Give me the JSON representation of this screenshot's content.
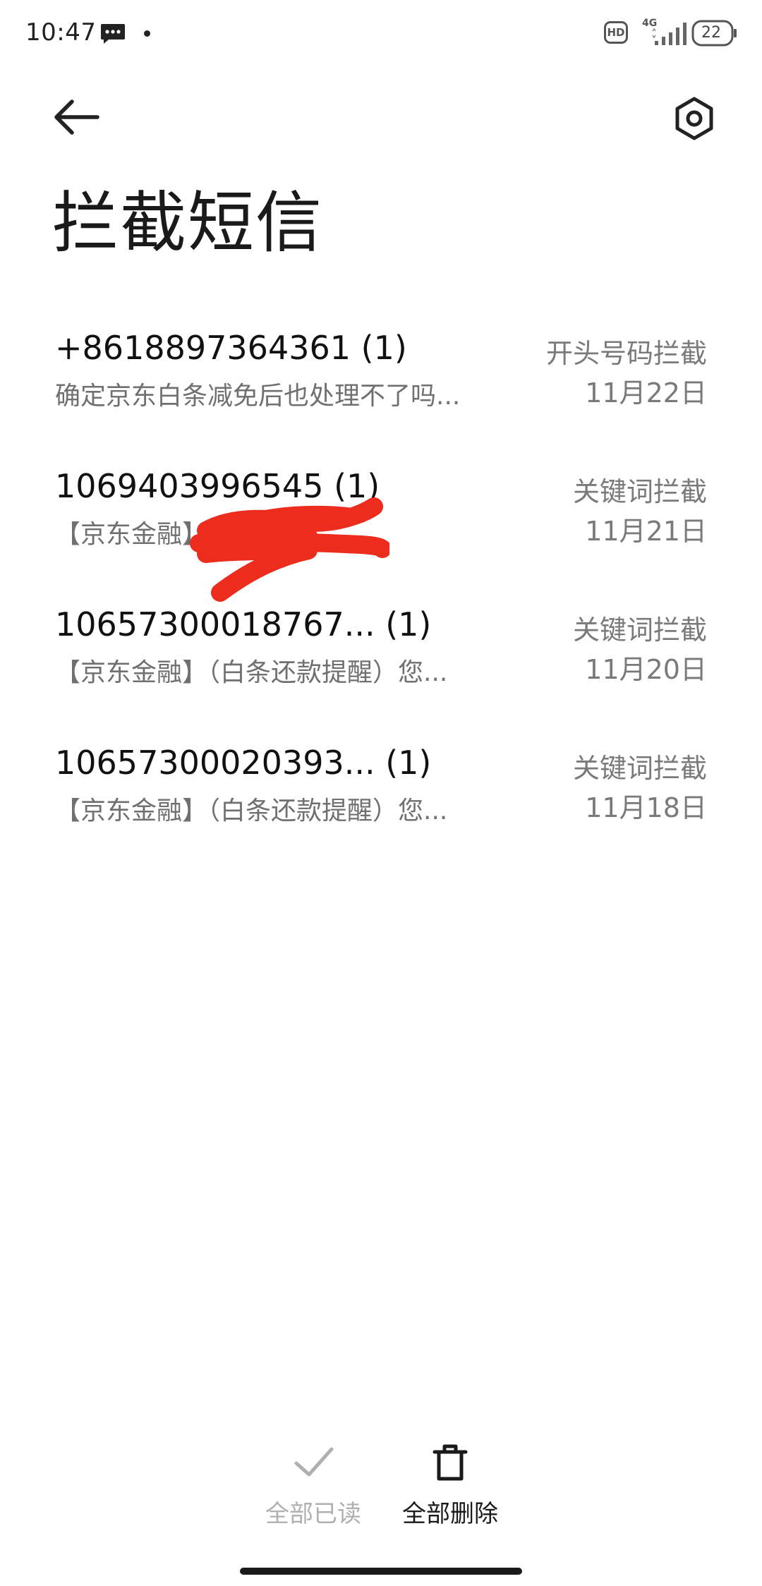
{
  "status_bar": {
    "time": "10:47",
    "hd_label": "HD",
    "network_label": "4G",
    "battery_level": "22"
  },
  "header": {
    "back_icon": "arrow-left-icon",
    "settings_icon": "hexagon-settings-icon",
    "title": "拦截短信"
  },
  "messages": [
    {
      "sender": "+8618897364361 (1)",
      "preview": "确定京东白条减免后也处理不了吗...",
      "rule": "开头号码拦截",
      "date": "11月22日"
    },
    {
      "sender": "1069403996545 (1)",
      "preview": "【京东金融】 生/女士，...",
      "rule": "关键词拦截",
      "date": "11月21日"
    },
    {
      "sender": "10657300018767...  (1)",
      "preview": "【京东金融】（白条还款提醒）您...",
      "rule": "关键词拦截",
      "date": "11月20日"
    },
    {
      "sender": "10657300020393...  (1)",
      "preview": "【京东金融】（白条还款提醒）您...",
      "rule": "关键词拦截",
      "date": "11月18日"
    }
  ],
  "bottom_actions": {
    "mark_all_read": {
      "label": "全部已读",
      "icon": "checkmark-icon",
      "enabled": false
    },
    "delete_all": {
      "label": "全部删除",
      "icon": "trash-icon",
      "enabled": true
    }
  },
  "colors": {
    "background": "#ffffff",
    "primary_text": "#111111",
    "secondary_text": "#707070",
    "disabled_text": "#b0b0b0",
    "redaction": "#ec2c1c"
  }
}
